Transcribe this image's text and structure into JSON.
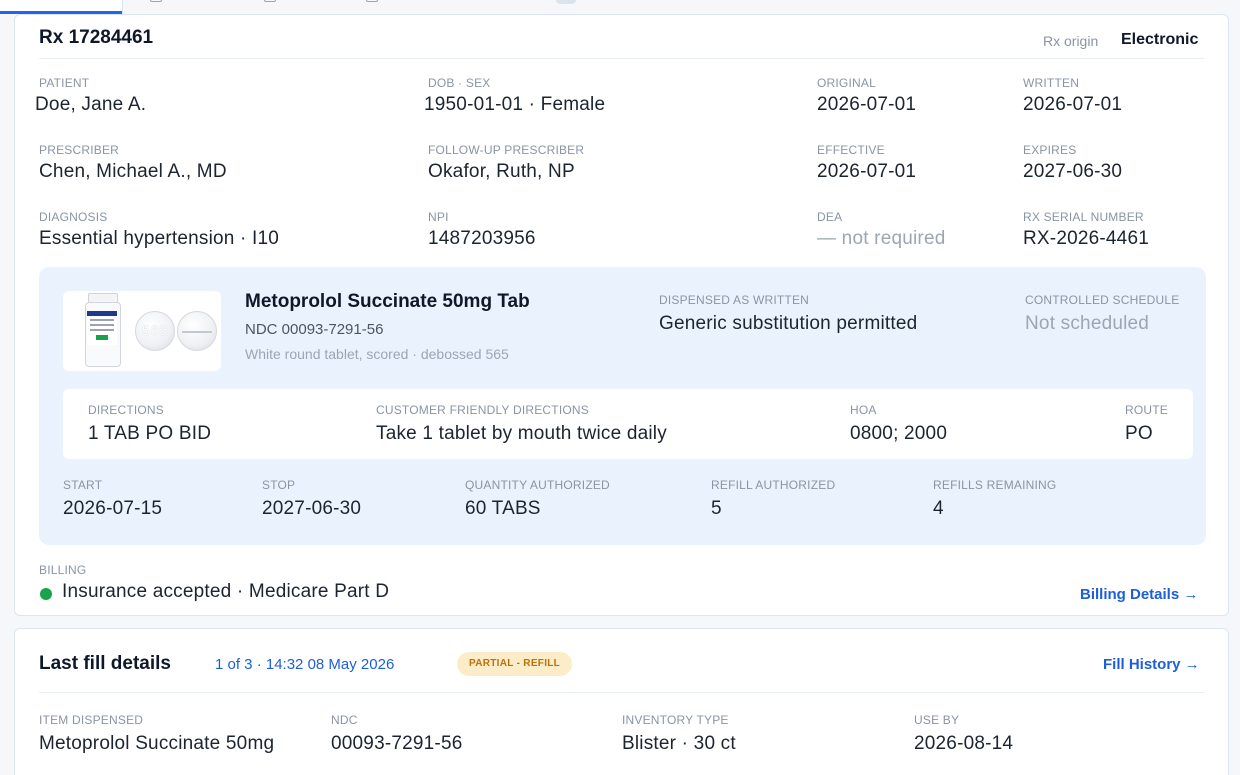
{
  "rx": {
    "title": "Rx 17284461",
    "origin_label": "Rx origin",
    "origin_value": "Electronic",
    "fields": {
      "patient": {
        "label": "PATIENT",
        "value": "Doe, Jane A."
      },
      "dob_sex": {
        "label": "DOB · SEX",
        "value": "1950-01-01 · Female"
      },
      "original": {
        "label": "ORIGINAL",
        "value": "2026-07-01"
      },
      "written": {
        "label": "WRITTEN",
        "value": "2026-07-01"
      },
      "prescriber": {
        "label": "PRESCRIBER",
        "value": "Chen, Michael A., MD"
      },
      "followup": {
        "label": "FOLLOW-UP PRESCRIBER",
        "value": "Okafor, Ruth, NP"
      },
      "effective": {
        "label": "EFFECTIVE",
        "value": "2026-07-01"
      },
      "expires": {
        "label": "EXPIRES",
        "value": "2027-06-30"
      },
      "diagnosis": {
        "label": "DIAGNOSIS",
        "value": "Essential hypertension · I10"
      },
      "npi": {
        "label": "NPI",
        "value": "1487203956"
      },
      "dea": {
        "label": "DEA",
        "value": "— not required"
      },
      "serial": {
        "label": "RX SERIAL NUMBER",
        "value": "RX-2026-4461"
      }
    }
  },
  "drug": {
    "name": "Metoprolol Succinate 50mg Tab",
    "ndc": "NDC 00093-7291-56",
    "description": "White round tablet, scored · debossed 565",
    "pill_imprint": "565",
    "daw": {
      "label": "DISPENSED AS WRITTEN",
      "value": "Generic substitution permitted"
    },
    "schedule": {
      "label": "CONTROLLED SCHEDULE",
      "value": "Not scheduled"
    },
    "directions": {
      "label": "DIRECTIONS",
      "value": "1 TAB PO BID"
    },
    "friendly": {
      "label": "CUSTOMER FRIENDLY DIRECTIONS",
      "value": "Take 1 tablet by mouth twice daily"
    },
    "hoa": {
      "label": "HOA",
      "value": "0800; 2000"
    },
    "route": {
      "label": "ROUTE",
      "value": "PO"
    },
    "start": {
      "label": "START",
      "value": "2026-07-15"
    },
    "stop": {
      "label": "STOP",
      "value": "2027-06-30"
    },
    "qty": {
      "label": "QUANTITY AUTHORIZED",
      "value": "60 TABS"
    },
    "refill_auth": {
      "label": "REFILL AUTHORIZED",
      "value": "5"
    },
    "refills_remaining": {
      "label": "REFILLS REMAINING",
      "value": "4"
    }
  },
  "billing": {
    "label": "BILLING",
    "status": "Insurance accepted · Medicare Part D",
    "status_color": "#16a34a",
    "details_link": "Billing Details →"
  },
  "last_fill": {
    "title": "Last fill details",
    "meta": "1 of 3 · 14:32  08 May 2026",
    "badge": "PARTIAL - REFILL",
    "history_link": "Fill History →",
    "item": {
      "label": "ITEM DISPENSED",
      "value": "Metoprolol Succinate 50mg"
    },
    "ndc": {
      "label": "NDC",
      "value": "00093-7291-56"
    },
    "inventory": {
      "label": "INVENTORY TYPE",
      "value": "Blister · 30 ct"
    },
    "use_by": {
      "label": "USE BY",
      "value": "2026-08-14"
    }
  }
}
